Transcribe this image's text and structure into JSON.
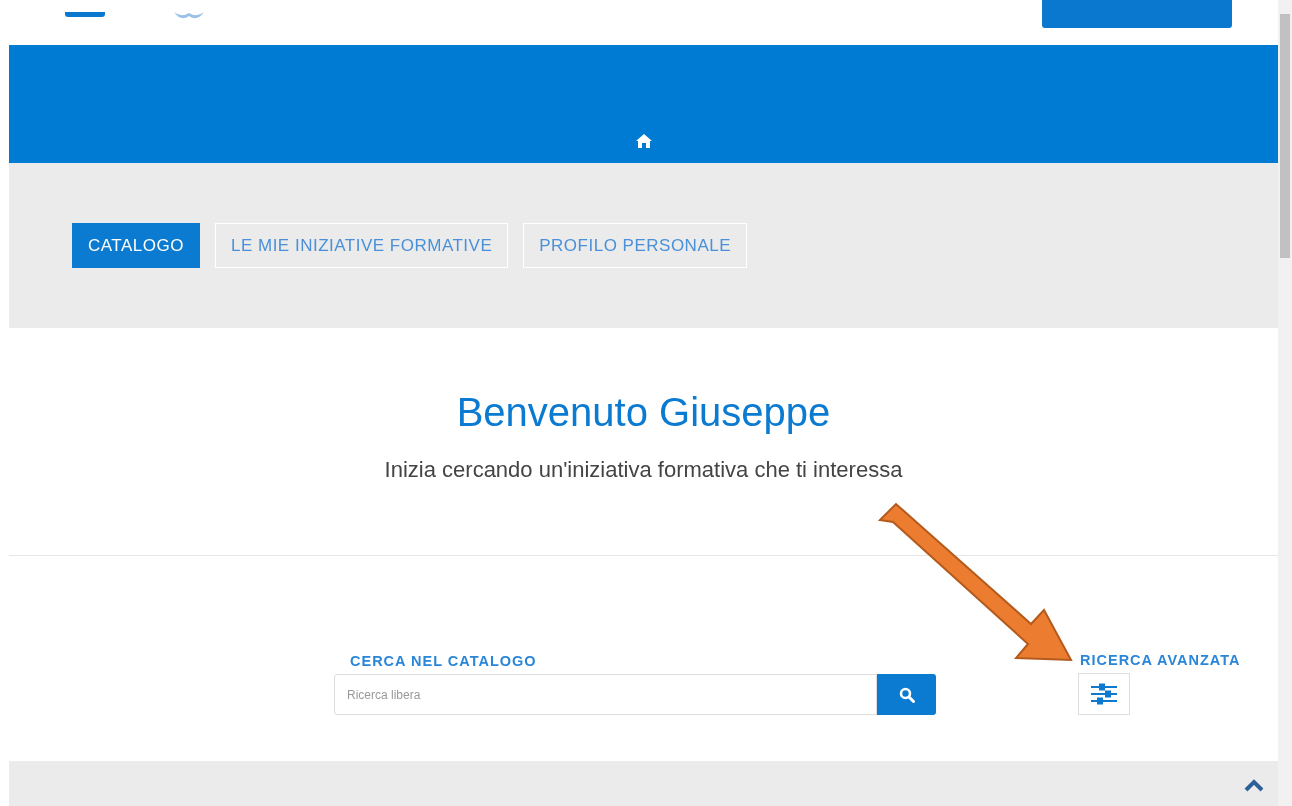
{
  "tabs": [
    {
      "label": "CATALOGO",
      "selected": true
    },
    {
      "label": "LE MIE INIZIATIVE FORMATIVE",
      "selected": false
    },
    {
      "label": "PROFILO PERSONALE",
      "selected": false
    }
  ],
  "welcome": {
    "title": "Benvenuto Giuseppe",
    "subtitle": "Inizia cercando un'iniziativa formativa che ti interessa"
  },
  "search": {
    "label": "CERCA NEL CATALOGO",
    "placeholder": "Ricerca libera"
  },
  "advanced_search": {
    "label": "RICERCA AVANZATA"
  }
}
